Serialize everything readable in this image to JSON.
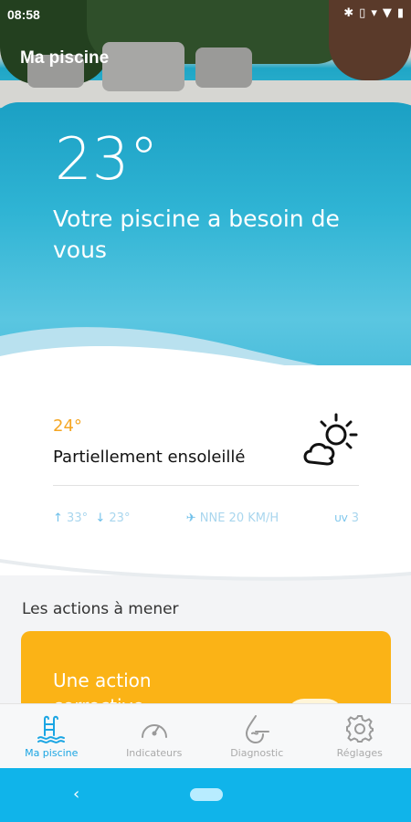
{
  "status_bar": {
    "time": "08:58",
    "icons": [
      "bluetooth-icon",
      "vibrate-icon",
      "signal-icon",
      "wifi-icon",
      "battery-icon"
    ]
  },
  "header": {
    "title": "Ma piscine"
  },
  "pool": {
    "temperature": "23°",
    "message": "Votre piscine a besoin de vous"
  },
  "weather": {
    "temperature": "24°",
    "description": "Partiellement ensoleillé",
    "max": "33°",
    "min": "23°",
    "wind": "NNE 20 KM/H",
    "uv_label": "UV",
    "uv_value": "3"
  },
  "actions": {
    "title": "Les actions à mener",
    "card_text": "Une action corrective"
  },
  "bottom_nav": {
    "items": [
      {
        "label": "Ma piscine",
        "icon": "pool-ladder-icon",
        "active": true
      },
      {
        "label": "Indicateurs",
        "icon": "gauge-icon",
        "active": false
      },
      {
        "label": "Diagnostic",
        "icon": "water-drop-icon",
        "active": false
      },
      {
        "label": "Réglages",
        "icon": "gear-icon",
        "active": false
      }
    ]
  },
  "colors": {
    "accent": "#1aa5e3",
    "warning": "#fbb316",
    "temp": "#f5a623",
    "system_nav": "#10b4ea"
  }
}
